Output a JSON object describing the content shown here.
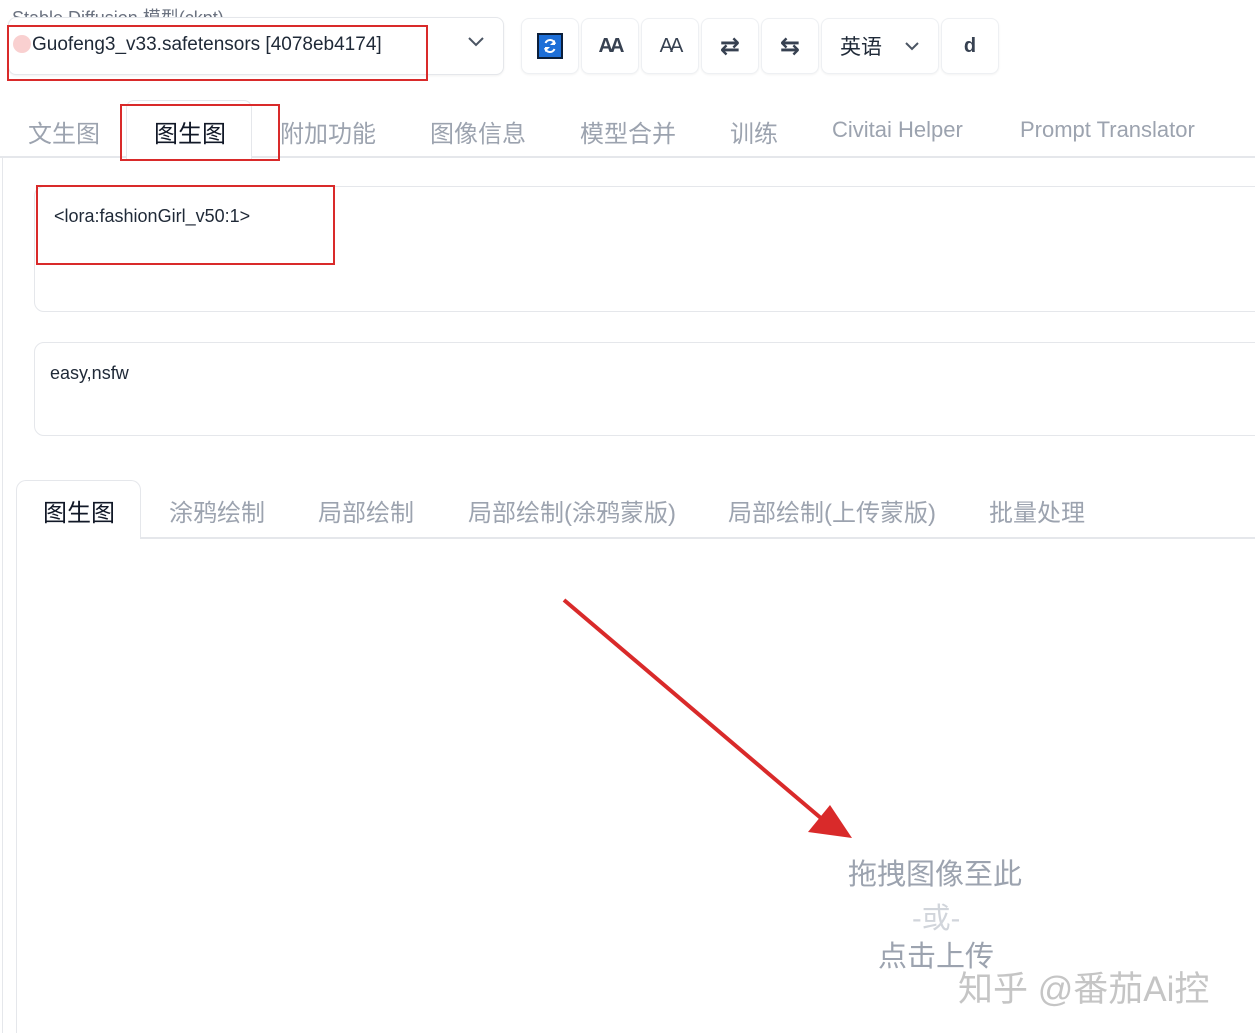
{
  "model": {
    "label": "Stable Diffusion 模型(ckpt)",
    "value": "Guofeng3_v33.safetensors [4078eb4174]"
  },
  "toolbar": {
    "refresh_icon": "refresh-icon",
    "font_a": "AA",
    "font_b": "AA",
    "swap_icon": "⇄",
    "swap_alt_icon": "⇆",
    "language": "英语",
    "extra": "d"
  },
  "main_tabs": [
    {
      "label": "文生图"
    },
    {
      "label": "图生图"
    },
    {
      "label": "附加功能"
    },
    {
      "label": "图像信息"
    },
    {
      "label": "模型合并"
    },
    {
      "label": "训练"
    },
    {
      "label": "Civitai Helper"
    },
    {
      "label": "Prompt Translator"
    }
  ],
  "prompt": {
    "positive": "<lora:fashionGirl_v50:1>",
    "negative": "easy,nsfw"
  },
  "sub_tabs": [
    {
      "label": "图生图"
    },
    {
      "label": "涂鸦绘制"
    },
    {
      "label": "局部绘制"
    },
    {
      "label": "局部绘制(涂鸦蒙版)"
    },
    {
      "label": "局部绘制(上传蒙版)"
    },
    {
      "label": "批量处理"
    }
  ],
  "upload": {
    "drop": "拖拽图像至此",
    "or": "-或-",
    "click": "点击上传"
  },
  "watermark": "知乎 @番茄Ai控",
  "colors": {
    "annotation_red": "#d92a2a",
    "refresh_blue": "#1d6fd8"
  }
}
